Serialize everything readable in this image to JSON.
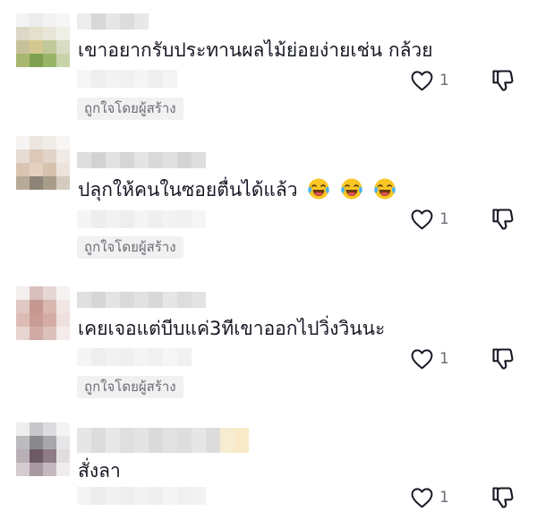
{
  "comments": [
    {
      "text": "เขาอยากรับประทานผลไม้ย่อยง่ายเช่น กล้วย",
      "emojis": [],
      "creator_badge": "ถูกใจโดยผู้สร้าง",
      "like_count": "1"
    },
    {
      "text": "ปลุกให้คนในซอยตื่นได้แล้ว",
      "emojis": [
        "face-with-tears-of-joy",
        "face-with-tears-of-joy",
        "face-with-tears-of-joy"
      ],
      "creator_badge": "ถูกใจโดยผู้สร้าง",
      "like_count": "1"
    },
    {
      "text": "เคยเจอแต่บีบแค่3ทีเขาออกไปวิ่งวินนะ",
      "emojis": [],
      "creator_badge": "ถูกใจโดยผู้สร้าง",
      "like_count": "1"
    },
    {
      "text": "สั่งลา",
      "emojis": [],
      "creator_badge": "",
      "like_count": "1"
    }
  ],
  "icons": {
    "like": "heart-outline-icon",
    "dislike": "thumbs-down-outline-icon",
    "emoji": "face-with-tears-of-joy"
  },
  "colors": {
    "text": "#161823",
    "muted": "#6b6d75",
    "badge_bg": "#f1f1f2"
  }
}
